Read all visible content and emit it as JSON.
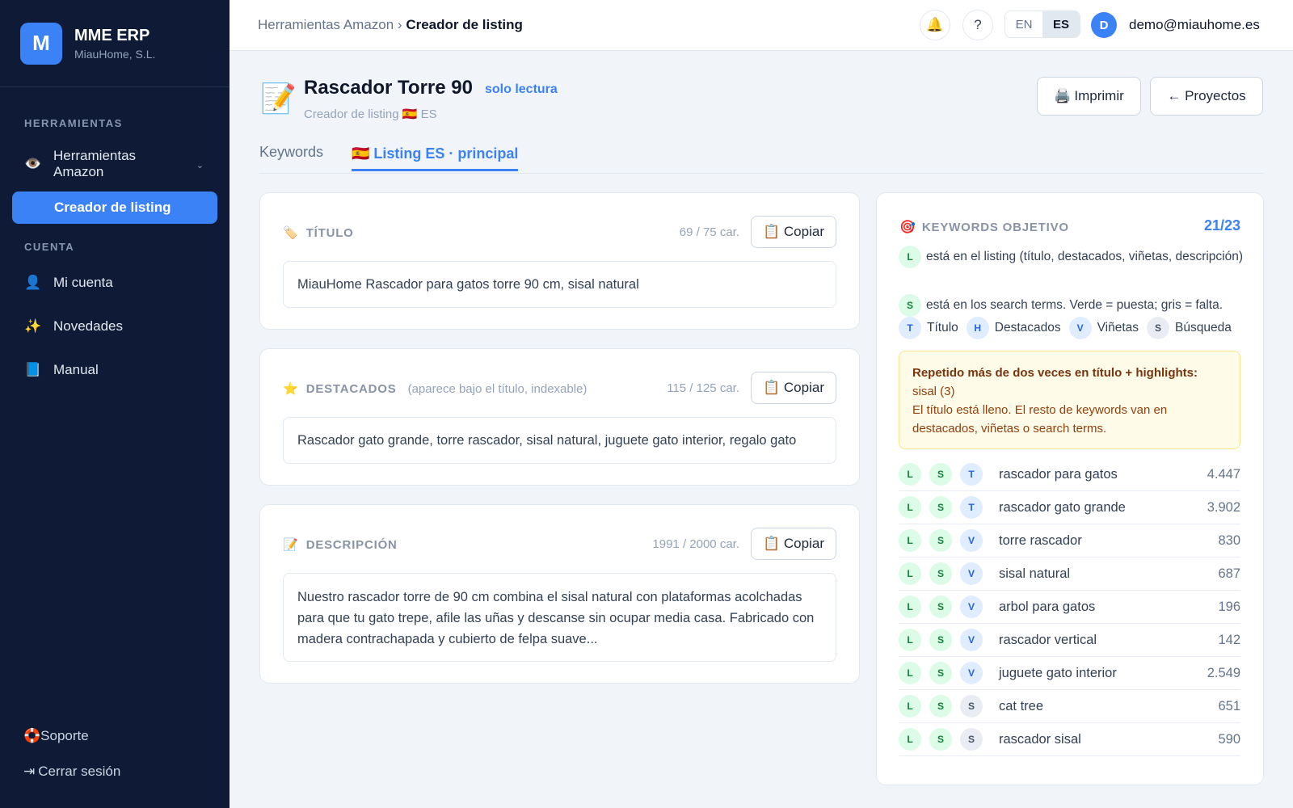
{
  "sidebar": {
    "brand": {
      "logo_letter": "M",
      "name": "MME ERP",
      "company": "MiauHome, S.L."
    },
    "sections": {
      "tools": "HERRAMIENTAS",
      "account": "CUENTA"
    },
    "amazon_tools": {
      "icon": "eye-icon",
      "label": "Herramientas Amazon"
    },
    "listing_creator": "Creador de listing",
    "account_items": [
      {
        "icon": "user-icon",
        "glyph": "👤",
        "label": "Mi cuenta"
      },
      {
        "icon": "sparkles-icon",
        "glyph": "✨",
        "label": "Novedades"
      },
      {
        "icon": "book-icon",
        "glyph": "📘",
        "label": "Manual"
      }
    ],
    "support": "Soporte",
    "logout": "Cerrar sesión"
  },
  "header": {
    "breadcrumb_parent": "Herramientas Amazon",
    "breadcrumb_separator": "›",
    "breadcrumb_current": "Creador de listing",
    "help": "?",
    "lang_en": "EN",
    "lang_es": "ES",
    "avatar_letter": "D",
    "email": "demo@miauhome.es"
  },
  "page": {
    "title": "Rascador Torre 90",
    "readonly_badge": "solo lectura",
    "subtitle": "Creador de listing 🇪🇸 ES",
    "print_label": "Imprimir",
    "projects_label": "← Proyectos"
  },
  "tabs": [
    {
      "label": "Keywords",
      "active": false
    },
    {
      "label": "🇪🇸 Listing ES · principal",
      "active": true
    }
  ],
  "copy_label": "📋 Copiar",
  "title_card": {
    "heading": "TÍTULO",
    "count": "69 / 75 car.",
    "value": "MiauHome Rascador para gatos torre 90 cm, sisal natural"
  },
  "highlights_card": {
    "heading": "DESTACADOS",
    "note": "(aparece bajo el título, indexable)",
    "count": "115 / 125 car.",
    "value": "Rascador gato grande, torre rascador, sisal natural, juguete gato interior, regalo gato"
  },
  "description_card": {
    "heading": "DESCRIPCIÓN",
    "count": "1991 / 2000 car.",
    "value": "Nuestro rascador torre de 90 cm combina el sisal natural con plataformas acolchadas para que tu gato trepe, afile las uñas y descanse sin ocupar media casa. Fabricado con madera contrachapada y cubierto de felpa suave..."
  },
  "keywords": {
    "heading": "KEYWORDS OBJETIVO",
    "score": "21/23",
    "legend_l": "está en el listing (título, destacados, viñetas, descripción)",
    "legend_s": "está en los search terms. Verde = puesta; gris = falta.",
    "legend_items": [
      {
        "chip": "T",
        "label": "Título"
      },
      {
        "chip": "H",
        "label": "Destacados"
      },
      {
        "chip": "V",
        "label": "Viñetas"
      },
      {
        "chip": "S",
        "label": "Búsqueda"
      }
    ],
    "warning_title": "Repetido más de dos veces en título + highlights:",
    "warning_terms": "sisal (3)",
    "warning_text": "El título está lleno. El resto de keywords van en destacados, viñetas o search terms.",
    "rows": [
      {
        "l": "L",
        "s": "S",
        "loc": "T",
        "term": "rascador para gatos",
        "volume": "4.447"
      },
      {
        "l": "L",
        "s": "S",
        "loc": "T",
        "term": "rascador gato grande",
        "volume": "3.902"
      },
      {
        "l": "L",
        "s": "S",
        "loc": "V",
        "term": "torre rascador",
        "volume": "830"
      },
      {
        "l": "L",
        "s": "S",
        "loc": "V",
        "term": "sisal natural",
        "volume": "687"
      },
      {
        "l": "L",
        "s": "S",
        "loc": "V",
        "term": "arbol para gatos",
        "volume": "196"
      },
      {
        "l": "L",
        "s": "S",
        "loc": "V",
        "term": "rascador vertical",
        "volume": "142"
      },
      {
        "l": "L",
        "s": "S",
        "loc": "V",
        "term": "juguete gato interior",
        "volume": "2.549"
      },
      {
        "l": "L",
        "s": "S",
        "loc": "S",
        "term": "cat tree",
        "volume": "651"
      },
      {
        "l": "L",
        "s": "S",
        "loc": "S",
        "term": "rascador sisal",
        "volume": "590"
      }
    ]
  },
  "colors": {
    "accent": "#3b82f6",
    "sidebar_bg": "#0f1b36",
    "warn_bg": "#fefce8",
    "chip_green": "#dcfce7",
    "chip_blue": "#e0ecff"
  }
}
